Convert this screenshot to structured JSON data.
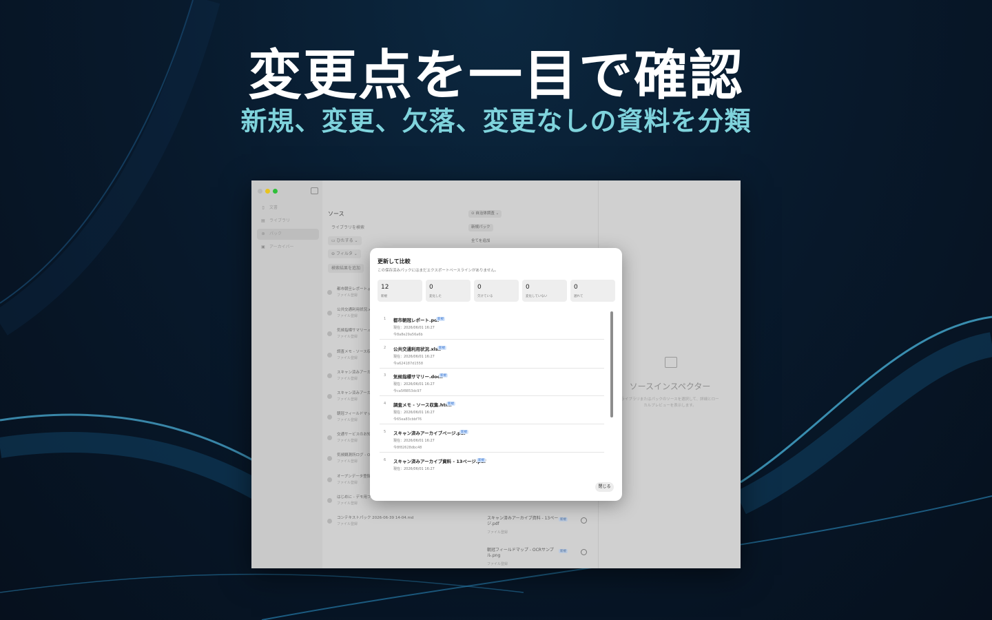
{
  "headline": "変更点を一目で確認",
  "subheadline": "新規、変更、欠落、変更なしの資料を分類",
  "colors": {
    "accent": "#7fd3dc",
    "background": "#081a2d",
    "new_badge": "#2f6fd0"
  },
  "window": {
    "sidebar": {
      "items": [
        {
          "icon": "document-icon",
          "label": "文書"
        },
        {
          "icon": "library-icon",
          "label": "ライブラリ"
        },
        {
          "icon": "pack-icon",
          "label": "パック"
        },
        {
          "icon": "archive-icon",
          "label": "アーカイバー"
        }
      ]
    },
    "sources": {
      "title": "ソース",
      "add_library": "ライブラリを検索",
      "open_label": "ひたする",
      "filter_label": "フィルタ",
      "add_results": "検索結果を追加",
      "items": [
        {
          "name": "都市朝旦レポート.pdf",
          "sub": "ファイル登録"
        },
        {
          "name": "公共交通利用状況.xlsx",
          "sub": "ファイル登録"
        },
        {
          "name": "気候指標サマリー.docx",
          "sub": "ファイル登録"
        },
        {
          "name": "調査メモ - ソース収集...",
          "sub": "ファイル登録"
        },
        {
          "name": "スキャン済みアーカイブ...",
          "sub": "ファイル登録"
        },
        {
          "name": "スキャン済みアーカイブ...",
          "sub": "ファイル登録"
        },
        {
          "name": "朝冠フィールドマップ...",
          "sub": "ファイル登録"
        },
        {
          "name": "交通サービスのお知らせ...",
          "sub": "ファイル登録"
        },
        {
          "name": "気候観測所ログ - OCR...",
          "sub": "ファイル登録"
        },
        {
          "name": "オープンデータ登録案内...",
          "sub": "ファイル登録"
        },
        {
          "name": "はじめに - デモ用ファイル...",
          "sub": "ファイル登録"
        },
        {
          "name": "コンテキストパック 2026-06-39 14-04.md",
          "sub": "ファイル登録"
        }
      ]
    },
    "pack": {
      "selector": "自治体調査",
      "new_pack": "新規パック",
      "all_label": "全てを追加",
      "rows": [
        {
          "name": "スキャン済みアーカイブ資料 - 13ページ.pdf",
          "badge": "新規",
          "sub": "ファイル登録"
        },
        {
          "name": "朝冠フィールドマップ - OCRサンプル.png",
          "badge": "新規",
          "sub": "ファイル登録"
        }
      ]
    },
    "inspector": {
      "title": "ソースインスペクター",
      "description": "ライブラリまたはパックのソースを選択して、詳細とローカルプレビューを表示します。"
    }
  },
  "dialog": {
    "title": "更新して比較",
    "subtitle": "この保存済みパックにはまだエクスポートベースラインがありません。",
    "stats": [
      {
        "value": "12",
        "label": "新規"
      },
      {
        "value": "0",
        "label": "変化した"
      },
      {
        "value": "0",
        "label": "欠けている"
      },
      {
        "value": "0",
        "label": "変化していない"
      },
      {
        "value": "0",
        "label": "遅れて"
      }
    ],
    "items": [
      {
        "index": "1",
        "name": "都市朝冠レポート.pdf",
        "badge": "新規",
        "meta": "現在：2026/06/01 16:27",
        "hash": "今8a8e29a56a6b"
      },
      {
        "index": "2",
        "name": "公共交通利用状況.xlsx",
        "badge": "新規",
        "meta": "現在：2026/06/01 16:27",
        "hash": "今a624187d1558"
      },
      {
        "index": "3",
        "name": "気候指標サマリー.docx",
        "badge": "新規",
        "meta": "現在：2026/06/01 16:27",
        "hash": "今ca5f8853dc97"
      },
      {
        "index": "4",
        "name": "調査メモ - ソース収集.html",
        "badge": "新規",
        "meta": "現在：2026/06/01 16:27",
        "hash": "今65ea83cbbf76"
      },
      {
        "index": "5",
        "name": "スキャン済みアーカイブページ.pdf",
        "badge": "新規",
        "meta": "現在：2026/06/01 16:27",
        "hash": "今8f82628dbc48"
      },
      {
        "index": "6",
        "name": "スキャン済みアーカイブ資料 - 13ページ.pdf",
        "badge": "新規",
        "meta": "現在：2026/06/01 16:27",
        "hash": ""
      }
    ],
    "close_label": "閉じる"
  }
}
